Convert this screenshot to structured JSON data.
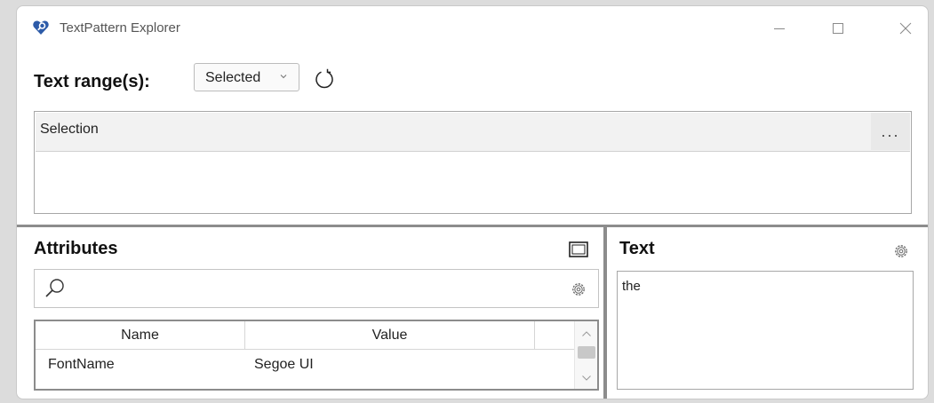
{
  "window": {
    "title": "TextPattern Explorer"
  },
  "icons": {
    "app": "heart-magnifier-icon",
    "minimize": "minimize-icon",
    "maximize": "maximize-icon",
    "close": "close-icon",
    "dropdown": "chevron-down-icon",
    "refresh": "refresh-icon",
    "more": "more-icon",
    "maximize_panel": "maximize-panel-icon",
    "search": "search-icon",
    "settings": "gear-icon"
  },
  "range": {
    "label": "Text range(s):",
    "selected": "Selected",
    "items": [
      {
        "label": "Selection",
        "more_label": "..."
      }
    ]
  },
  "attributes": {
    "title": "Attributes",
    "columns": [
      "Name",
      "Value"
    ],
    "rows": [
      {
        "name": "FontName",
        "value": "Segoe UI"
      }
    ]
  },
  "text_panel": {
    "title": "Text",
    "content": "the"
  },
  "colors": {
    "accent": "#2d5ba8",
    "splitter": "#8c8c8c"
  }
}
